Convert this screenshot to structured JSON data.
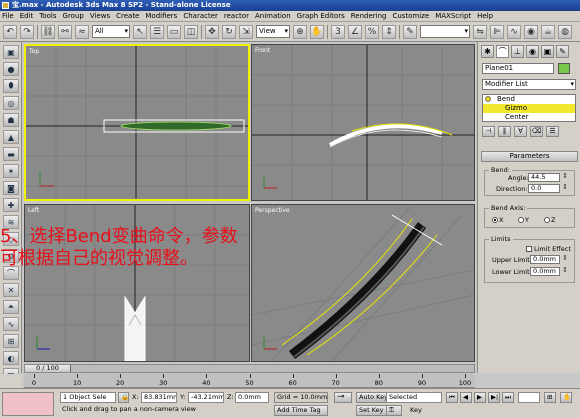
{
  "window": {
    "title": "宝.max - Autodesk 3ds Max 8 SP2 - Stand-alone License"
  },
  "menu": [
    "File",
    "Edit",
    "Tools",
    "Group",
    "Views",
    "Create",
    "Modifiers",
    "Character",
    "reactor",
    "Animation",
    "Graph Editors",
    "Rendering",
    "Customize",
    "MAXScript",
    "Help"
  ],
  "toolbar": {
    "selection_filter": "All",
    "ref_coord": "View"
  },
  "viewports": {
    "top": "Top",
    "front": "Front",
    "left": "Left",
    "perspective": "Perspective"
  },
  "annotation": {
    "line1": "5、选择Bend变曲命令，参数",
    "line2": "可根据自己的视觉调整。"
  },
  "command_panel": {
    "object_name": "Plane01",
    "modifier_list": "Modifier List",
    "stack": {
      "modifier": "Bend",
      "sub1": "Gizmo",
      "sub2": "Center"
    },
    "rollout_title": "Parameters",
    "bend_group": "Bend:",
    "angle_label": "Angle:",
    "angle_value": "44.5",
    "direction_label": "Direction:",
    "direction_value": "0.0",
    "axis_group": "Bend Axis:",
    "axis_x": "X",
    "axis_y": "Y",
    "axis_z": "Z",
    "limits_group": "Limits",
    "limit_effect": "Limit Effect",
    "upper_label": "Upper Limit:",
    "upper_value": "0.0mm",
    "lower_label": "Lower Limit:",
    "lower_value": "0.0mm"
  },
  "timeline": {
    "slider": "0 / 100",
    "ticks": [
      "0",
      "10",
      "20",
      "30",
      "40",
      "50",
      "60",
      "70",
      "80",
      "90",
      "100"
    ]
  },
  "status": {
    "selection": "1 Object Sele",
    "x_label": "X:",
    "x_value": "83.831mm",
    "y_label": "Y:",
    "y_value": "-43.21mm",
    "z_label": "Z:",
    "z_value": "0.0mm",
    "grid": "Grid = 10.0mm",
    "auto_key": "Auto Key",
    "set_key": "Set Key",
    "key_filter": "Selected",
    "key_label": "Key",
    "prompt": "Click and drag to pan a non-camera view",
    "add_time_tag": "Add Time Tag"
  },
  "colors": {
    "title_bar": "#1a3f8f",
    "active_viewport_border": "#f0f000",
    "stack_selection": "#f2e830",
    "annotation": "#e8101a",
    "object_color": "#7ac84a"
  }
}
